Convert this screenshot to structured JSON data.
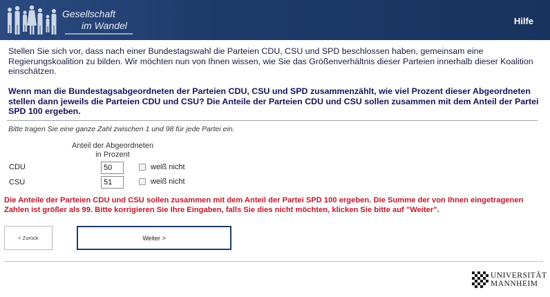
{
  "header": {
    "logo_line1": "Gesellschaft",
    "logo_line2": "im Wandel",
    "help_label": "Hilfe"
  },
  "intro_text": "Stellen Sie sich vor, dass nach einer Bundestagswahl die Parteien CDU, CSU und SPD beschlossen haben, gemeinsam eine Regierungskoalition zu bilden. Wir möchten nun von Ihnen wissen, wie Sie das Größenverhältnis dieser Parteien innerhalb dieser Koalition einschätzen.",
  "question_text": "Wenn man die Bundestagsabgeordneten der Parteien CDU, CSU und SPD zusammenzählt, wie viel Prozent dieser Abgeordneten stellen dann jeweils die Parteien CDU und CSU? Die Anteile der Parteien CDU und CSU sollen zusammen mit dem Anteil der Partei SPD 100 ergeben.",
  "instruction_text": "Bitte tragen Sie eine ganze Zahl zwischen 1 und 98 für jede Partei ein.",
  "column_header": {
    "line1": "Anteil der Abgeordneten",
    "line2": "in Prozent"
  },
  "rows": [
    {
      "party": "CDU",
      "value": "50",
      "dont_know_label": "weiß nicht",
      "dont_know_checked": false
    },
    {
      "party": "CSU",
      "value": "51",
      "dont_know_label": "weiß nicht",
      "dont_know_checked": false
    }
  ],
  "error_text": "Die Anteile der Parteien CDU und CSU sollen zusammen mit dem Anteil der Partei SPD 100 ergeben. Die Summe der von Ihnen eingetragenen Zahlen ist größer als 99. Bitte korrigieren Sie Ihre Eingaben, falls Sie dies nicht möchten, klicken Sie bitte auf \"Weiter\".",
  "buttons": {
    "back_label": "< Zurück",
    "next_label": "Weiter >"
  },
  "footer": {
    "uni_line1": "UNIVERSITÄT",
    "uni_line2": "MANNHEIM"
  },
  "colors": {
    "header_bg": "#1f3b6b",
    "error": "#c0172a",
    "question": "#14145a"
  },
  "icons": {
    "logo": "people-silhouettes-icon",
    "university_crest": "checkered-crest-icon"
  }
}
